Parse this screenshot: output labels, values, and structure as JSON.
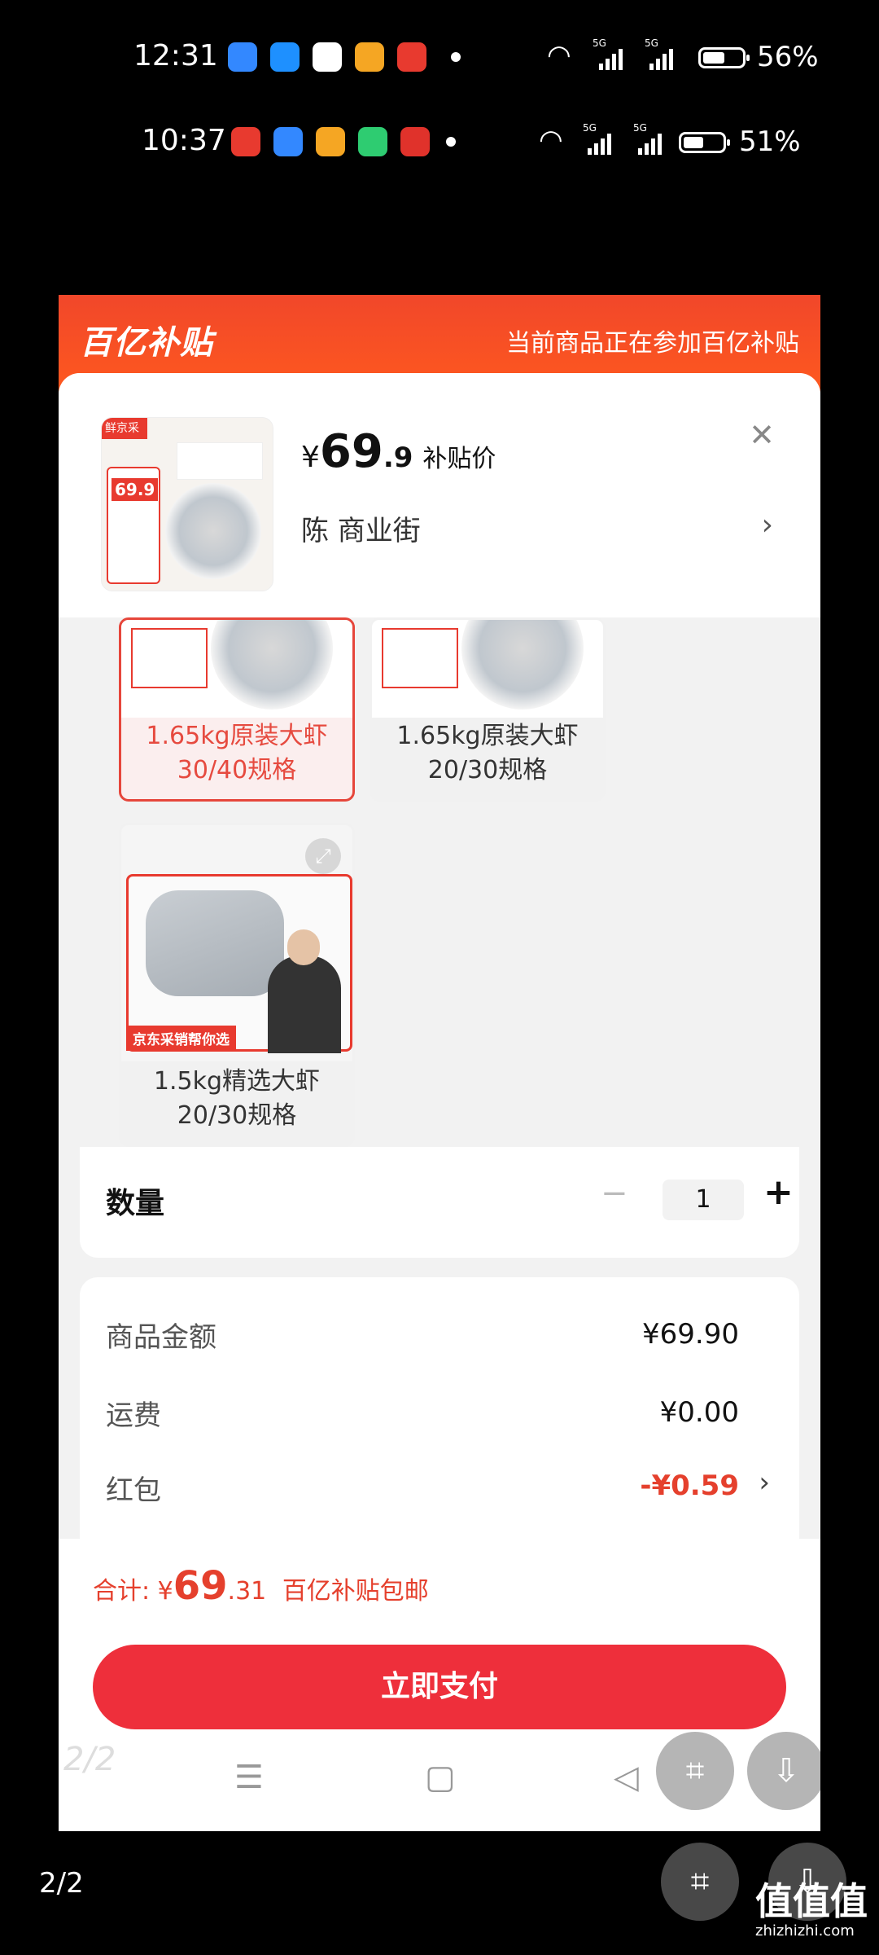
{
  "status_bar_top": {
    "time": "12:31",
    "signal1": "5G",
    "signal2": "5G",
    "battery": "56%"
  },
  "status_bar_second": {
    "time": "10:37",
    "signal1": "5G",
    "signal2": "5G",
    "battery": "51%"
  },
  "banner": {
    "logo": "百亿补贴",
    "notice": "当前商品正在参加百亿补贴"
  },
  "product": {
    "currency": "¥",
    "price_int": "69",
    "price_dec": ".9",
    "price_tag": "补贴价",
    "address": "陈  商业街",
    "thumb_brand": "鲜京采",
    "thumb_price": "69.9"
  },
  "variants": [
    {
      "line1": "1.65kg原装大虾",
      "line2": "30/40规格",
      "selected": true
    },
    {
      "line1": "1.65kg原装大虾",
      "line2": "20/30规格",
      "selected": false
    },
    {
      "line1": "1.5kg精选大虾",
      "line2": "20/30规格",
      "selected": false,
      "img_caption": "京东采销帮你选"
    }
  ],
  "quantity": {
    "label": "数量",
    "value": "1",
    "minus": "−",
    "plus": "+"
  },
  "costs": [
    {
      "label": "商品金额",
      "value": "¥69.90"
    },
    {
      "label": "运费",
      "value": "¥0.00"
    },
    {
      "label": "红包",
      "value": "-¥0.59"
    }
  ],
  "total": {
    "prefix": "合计:",
    "currency": "¥",
    "int": "69",
    "dec": ".31",
    "suffix": "百亿补贴包邮"
  },
  "pay_button": "立即支付",
  "page_counter_inner": "2/2",
  "page_counter_outer": "2/2",
  "watermark": {
    "text": "值值值",
    "sub": "zhizhizhi.com"
  },
  "colors": {
    "accent_red": "#ee2f3b",
    "banner_orange": "#ff5a1e",
    "price_red": "#e5402d"
  }
}
